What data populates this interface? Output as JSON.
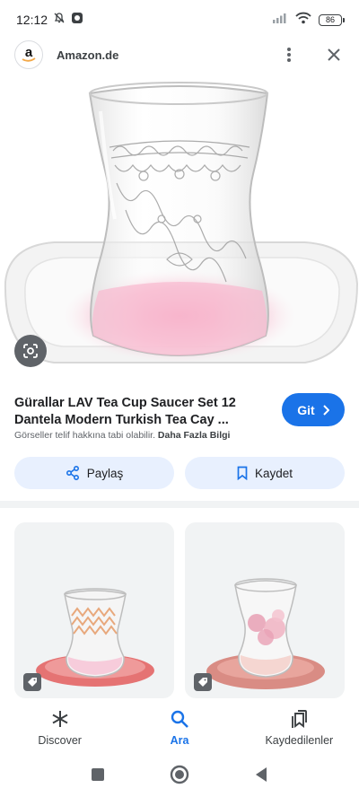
{
  "status_bar": {
    "time": "12:12",
    "battery": "86"
  },
  "header": {
    "site_name": "Amazon.de",
    "logo_letter": "a"
  },
  "result": {
    "title": "Gürallar LAV Tea Cup Saucer Set 12 Dantela Modern Turkish Tea Cay ...",
    "go_label": "Git",
    "copyright_text": "Görseller telif hakkına tabi olabilir.",
    "more_info_label": "Daha Fazla Bilgi"
  },
  "actions": {
    "share_label": "Paylaş",
    "save_label": "Kaydet"
  },
  "bottom_nav": {
    "items": [
      {
        "label": "Discover",
        "icon": "asterisk-icon",
        "active": false
      },
      {
        "label": "Ara",
        "icon": "search-icon",
        "active": true
      },
      {
        "label": "Kaydedilenler",
        "icon": "bookmarks-icon",
        "active": false
      }
    ]
  },
  "colors": {
    "accent": "#1a73e8",
    "chip_bg": "#e8f0fe",
    "glass_tint": "#f06292"
  }
}
